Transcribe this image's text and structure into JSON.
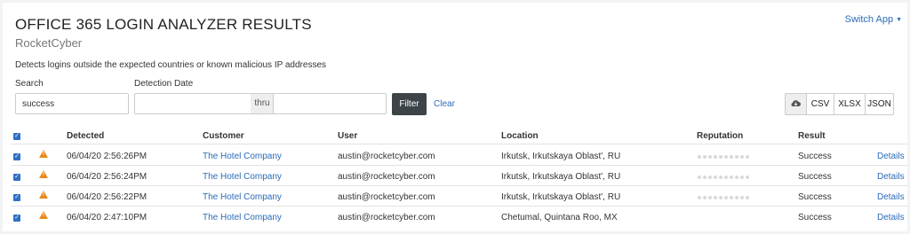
{
  "header": {
    "title": "OFFICE 365 LOGIN ANALYZER RESULTS",
    "subtitle": "RocketCyber",
    "switch_app": "Switch App",
    "description": "Detects logins outside the expected countries or known malicious IP addresses"
  },
  "filters": {
    "search_label": "Search",
    "search_value": "success",
    "date_label": "Detection Date",
    "date_from": "",
    "thru_label": "thru",
    "date_to": "",
    "filter_button": "Filter",
    "clear_link": "Clear"
  },
  "export": {
    "cloud_icon": "cloud-download-icon",
    "csv": "CSV",
    "xlsx": "XLSX",
    "json": "JSON"
  },
  "table": {
    "columns": [
      "Detected",
      "Customer",
      "User",
      "Location",
      "Reputation",
      "Result"
    ],
    "rows": [
      {
        "detected": "06/04/20 2:56:26PM",
        "customer": "The Hotel Company",
        "user": "austin@rocketcyber.com",
        "location": "Irkutsk, Irkutskaya Oblast', RU",
        "result": "Success",
        "details": "Details"
      },
      {
        "detected": "06/04/20 2:56:24PM",
        "customer": "The Hotel Company",
        "user": "austin@rocketcyber.com",
        "location": "Irkutsk, Irkutskaya Oblast', RU",
        "result": "Success",
        "details": "Details"
      },
      {
        "detected": "06/04/20 2:56:22PM",
        "customer": "The Hotel Company",
        "user": "austin@rocketcyber.com",
        "location": "Irkutsk, Irkutskaya Oblast', RU",
        "result": "Success",
        "details": "Details"
      },
      {
        "detected": "06/04/20 2:47:10PM",
        "customer": "The Hotel Company",
        "user": "austin@rocketcyber.com",
        "location": "Chetumal, Quintana Roo, MX",
        "result": "Success",
        "details": "Details"
      }
    ]
  },
  "colors": {
    "accent": "#2a6bb7",
    "checkbox": "#2f6fc2",
    "warning": "#e68a1e",
    "filter_button": "#3d4448"
  }
}
